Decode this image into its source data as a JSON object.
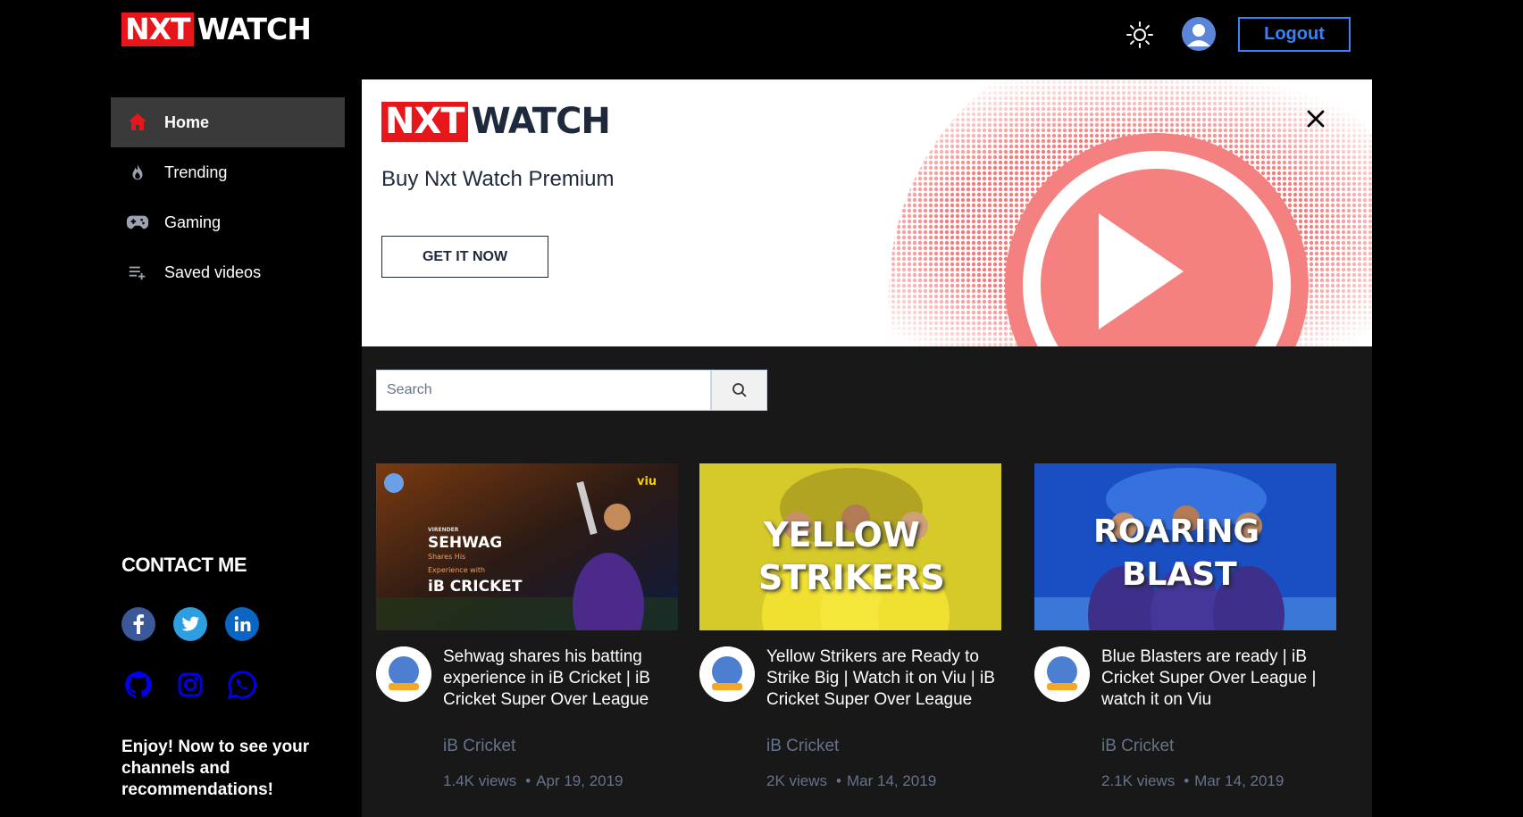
{
  "header": {
    "logo_part1": "NXT",
    "logo_part2": "WATCH",
    "theme_icon": "sun-icon",
    "profile_icon": "user-avatar-icon",
    "logout_label": "Logout"
  },
  "sidebar": {
    "items": [
      {
        "label": "Home",
        "icon": "home-icon",
        "active": true
      },
      {
        "label": "Trending",
        "icon": "fire-icon",
        "active": false
      },
      {
        "label": "Gaming",
        "icon": "gamepad-icon",
        "active": false
      },
      {
        "label": "Saved videos",
        "icon": "playlist-add-icon",
        "active": false
      }
    ],
    "contact_title": "CONTACT ME",
    "socials": [
      "facebook-icon",
      "twitter-icon",
      "linkedin-icon",
      "github-icon",
      "instagram-icon",
      "whatsapp-icon"
    ],
    "enjoy_text": "Enjoy! Now to see your channels and recommendations!"
  },
  "banner": {
    "logo_part1": "NXT",
    "logo_part2": "WATCH",
    "text": "Buy Nxt Watch Premium",
    "button_label": "GET IT NOW"
  },
  "search": {
    "placeholder": "Search"
  },
  "videos": [
    {
      "title": "Sehwag shares his batting experience in iB Cricket | iB Cricket Super Over League",
      "channel": "iB Cricket",
      "views": "1.4K views",
      "date": "Apr 19, 2019",
      "thumb_lines": [
        "VIRENDER",
        "SEHWAG",
        "Shares His",
        "Experience with",
        "iB CRICKET"
      ],
      "thumb_badge": "viu"
    },
    {
      "title": "Yellow Strikers are Ready to Strike Big | Watch it on Viu | iB Cricket Super Over League",
      "channel": "iB Cricket",
      "views": "2K views",
      "date": "Mar 14, 2019",
      "thumb_lines": [
        "YELLOW",
        "STRIKERS"
      ]
    },
    {
      "title": "Blue Blasters are ready | iB Cricket Super Over League | watch it on Viu",
      "channel": "iB Cricket",
      "views": "2.1K views",
      "date": "Mar 14, 2019",
      "thumb_lines": [
        "ROARING",
        "BLAST"
      ]
    }
  ],
  "colors": {
    "brand_red": "#e7161b",
    "logout_blue": "#3b82f6",
    "sidebar_active": "#3a3a3a",
    "main_bg": "#181818"
  }
}
